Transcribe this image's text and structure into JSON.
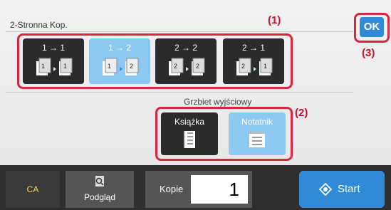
{
  "title": "2-Stronna Kop.",
  "callouts": [
    "(1)",
    "(2)",
    "(3)"
  ],
  "modes": [
    {
      "label": "1 → 1",
      "selected": false
    },
    {
      "label": "1 → 2",
      "selected": true
    },
    {
      "label": "2 → 2",
      "selected": false
    },
    {
      "label": "2 → 1",
      "selected": false
    }
  ],
  "binding": {
    "title": "Grzbiet wyjściowy",
    "options": [
      {
        "label": "Książka",
        "selected": false
      },
      {
        "label": "Notatnik",
        "selected": true
      }
    ]
  },
  "ok_label": "OK",
  "bottom": {
    "ca_label": "CA",
    "preview_label": "Podgląd",
    "copies_label": "Kopie",
    "copies_value": "1",
    "start_label": "Start"
  },
  "colors": {
    "accent": "#2f8ad8",
    "selected": "#8cc8ef",
    "highlight": "#d7263d",
    "dark_button": "#2b2b2b"
  }
}
